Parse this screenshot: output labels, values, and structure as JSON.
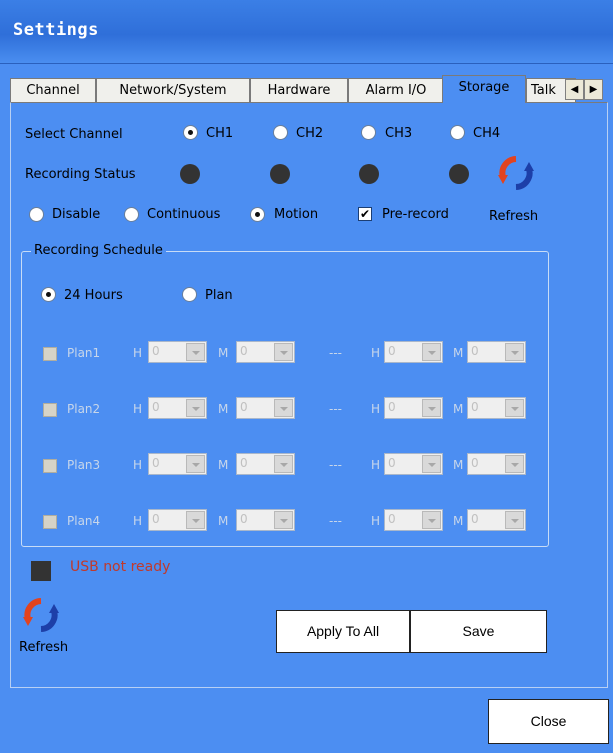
{
  "window": {
    "title": "Settings"
  },
  "tabs": [
    {
      "label": "Channel"
    },
    {
      "label": "Network/System"
    },
    {
      "label": "Hardware"
    },
    {
      "label": "Alarm I/O"
    },
    {
      "label": "Storage"
    },
    {
      "label": "Talk"
    }
  ],
  "tab_scroll": {
    "left": "◀",
    "right": "▶"
  },
  "active_tab": "Storage",
  "storage": {
    "select_channel_label": "Select Channel",
    "channels": [
      "CH1",
      "CH2",
      "CH3",
      "CH4"
    ],
    "selected_channel": "CH1",
    "recording_status_label": "Recording Status",
    "modes": [
      "Disable",
      "Continuous",
      "Motion"
    ],
    "selected_mode": "Motion",
    "prerecord_label": "Pre-record",
    "prerecord_checked": true,
    "prerecord_mark": "✔",
    "refresh_label": "Refresh",
    "schedule": {
      "label": "Recording Schedule",
      "options": [
        "24 Hours",
        "Plan"
      ],
      "selected": "24 Hours",
      "h_label": "H",
      "m_label": "M",
      "separator": "---",
      "plans": [
        {
          "label": "Plan1",
          "start_h": "0",
          "start_m": "0",
          "end_h": "0",
          "end_m": "0"
        },
        {
          "label": "Plan2",
          "start_h": "0",
          "start_m": "0",
          "end_h": "0",
          "end_m": "0"
        },
        {
          "label": "Plan3",
          "start_h": "0",
          "start_m": "0",
          "end_h": "0",
          "end_m": "0"
        },
        {
          "label": "Plan4",
          "start_h": "0",
          "start_m": "0",
          "end_h": "0",
          "end_m": "0"
        }
      ]
    },
    "usb_status": "USB not ready",
    "usb_status_color": "#c0392b",
    "refresh_bottom_label": "Refresh",
    "apply_to_all_label": "Apply To All",
    "save_label": "Save"
  },
  "close_label": "Close",
  "icons": {
    "refresh": "refresh-icon",
    "status_led": "status-dot-icon",
    "usb": "usb-status-icon"
  }
}
